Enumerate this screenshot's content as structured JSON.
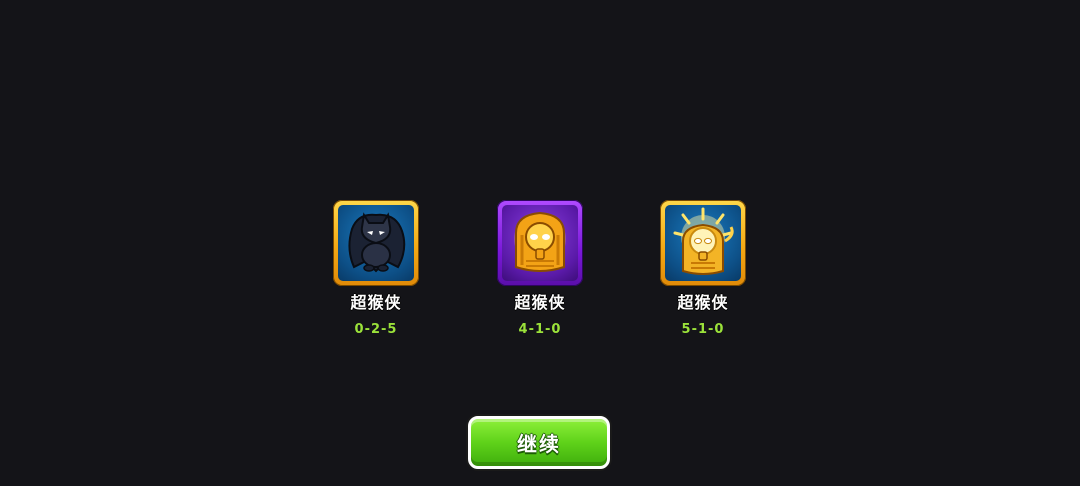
{
  "upgrades": [
    {
      "name": "超猴侠",
      "path": "0-2-5",
      "icon": "dark-knight-monkey-icon",
      "frame_color": "#f4a915"
    },
    {
      "name": "超猴侠",
      "path": "4-1-0",
      "icon": "golden-pharaoh-monkey-icon",
      "frame_color": "#7a18d8"
    },
    {
      "name": "超猴侠",
      "path": "5-1-0",
      "icon": "radiant-sun-monkey-icon",
      "frame_color": "#f4a915"
    }
  ],
  "continue_button": {
    "label": "继续",
    "color": "#5fd21a"
  },
  "theme": {
    "background": "#141418",
    "path_color": "#9be23a"
  }
}
